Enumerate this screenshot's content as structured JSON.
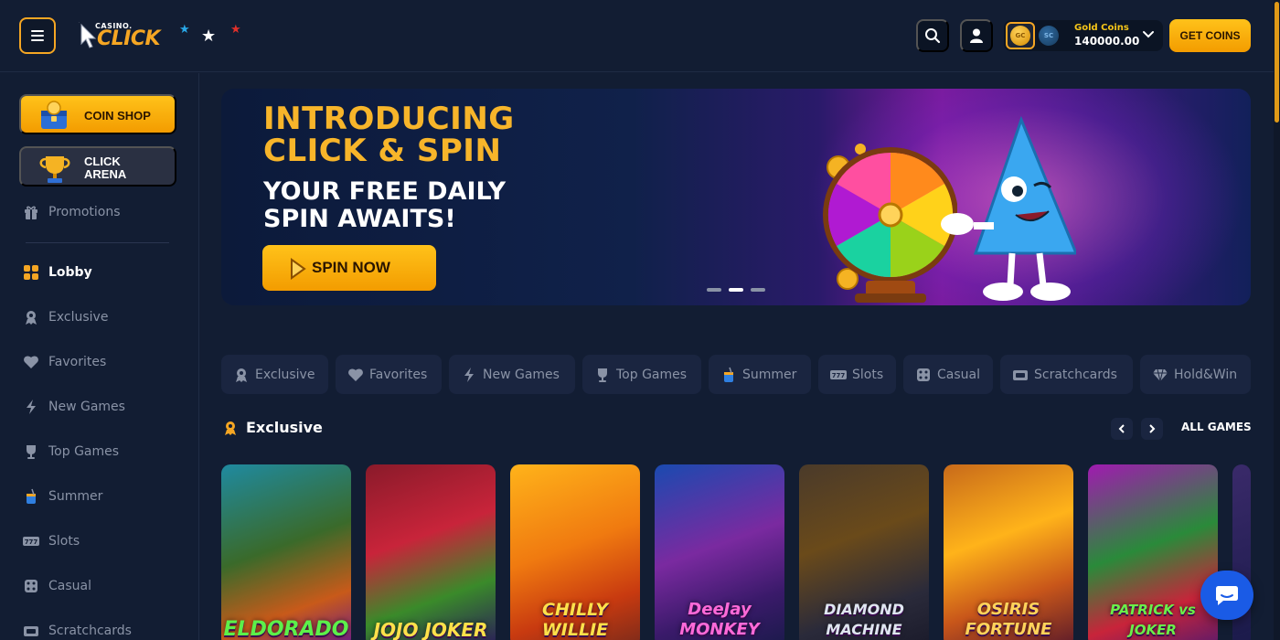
{
  "header": {
    "logo_top": "CASINO.",
    "logo_main": "CLICK",
    "wallet": {
      "gc_badge": "GC",
      "sc_badge": "SC",
      "label": "Gold Coins",
      "amount": "140000.00"
    },
    "get_coins_label": "GET COINS"
  },
  "sidebar": {
    "coin_shop": "COIN SHOP",
    "click_arena_line1": "CLICK",
    "click_arena_line2": "ARENA",
    "promotions": "Promotions",
    "items": [
      {
        "label": "Lobby",
        "icon": "grid-icon"
      },
      {
        "label": "Exclusive",
        "icon": "award-icon"
      },
      {
        "label": "Favorites",
        "icon": "heart-icon"
      },
      {
        "label": "New Games",
        "icon": "bolt-icon"
      },
      {
        "label": "Top Games",
        "icon": "trophy-icon"
      },
      {
        "label": "Summer",
        "icon": "drink-icon"
      },
      {
        "label": "Slots",
        "icon": "slots-icon"
      },
      {
        "label": "Casual",
        "icon": "dice-icon"
      },
      {
        "label": "Scratchcards",
        "icon": "ticket-icon"
      }
    ]
  },
  "banner": {
    "headline_1": "INTRODUCING",
    "headline_2": "CLICK & SPIN",
    "sub_1": "YOUR FREE DAILY",
    "sub_2": "SPIN AWAITS!",
    "cta": "SPIN NOW",
    "active_slide": 2,
    "slide_count": 3
  },
  "categories": [
    {
      "label": "Exclusive",
      "icon": "award-icon"
    },
    {
      "label": "Favorites",
      "icon": "heart-icon"
    },
    {
      "label": "New Games",
      "icon": "bolt-icon"
    },
    {
      "label": "Top Games",
      "icon": "trophy-icon"
    },
    {
      "label": "Summer",
      "icon": "drink-icon"
    },
    {
      "label": "Slots",
      "icon": "slots-icon"
    },
    {
      "label": "Casual",
      "icon": "dice-icon"
    },
    {
      "label": "Scratchcards",
      "icon": "ticket-icon"
    },
    {
      "label": "Hold&Win",
      "icon": "gem-icon"
    }
  ],
  "section": {
    "title": "Exclusive",
    "all_games": "ALL GAMES"
  },
  "games": [
    {
      "name": "ELDORADO"
    },
    {
      "name": "JOJO JOKER"
    },
    {
      "name": "CHILLY WILLIE"
    },
    {
      "name": "DeeJay MONKEY"
    },
    {
      "name": "DIAMOND MACHINE"
    },
    {
      "name": "OSIRIS FORTUNE"
    },
    {
      "name": "PATRICK vs JOKER"
    }
  ],
  "colors": {
    "background": "#121d33",
    "accent": "#f5a623",
    "chip": "#1a2540",
    "chat": "#1a5be6"
  }
}
